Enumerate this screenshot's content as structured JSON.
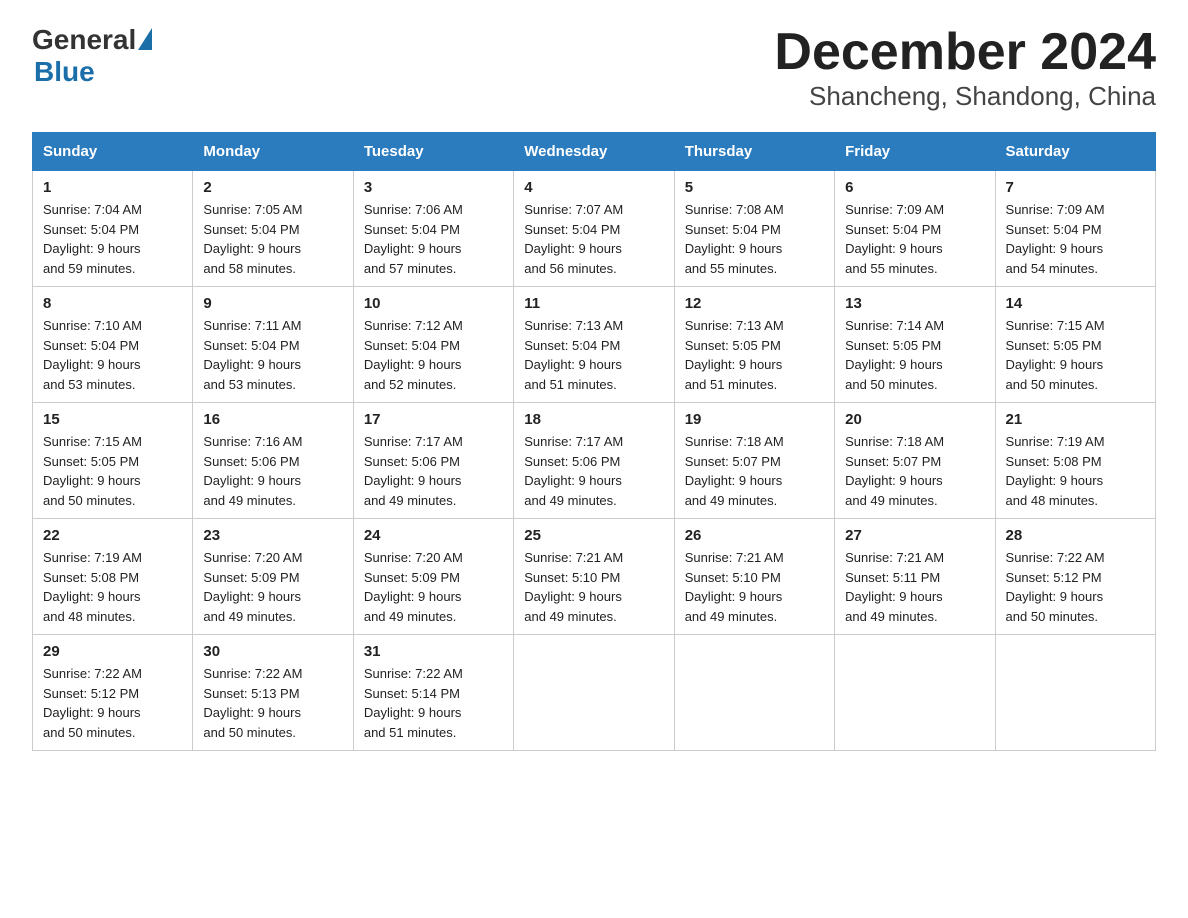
{
  "header": {
    "title": "December 2024",
    "subtitle": "Shancheng, Shandong, China",
    "logo_general": "General",
    "logo_blue": "Blue"
  },
  "columns": [
    "Sunday",
    "Monday",
    "Tuesday",
    "Wednesday",
    "Thursday",
    "Friday",
    "Saturday"
  ],
  "weeks": [
    [
      {
        "num": "1",
        "info": "Sunrise: 7:04 AM\nSunset: 5:04 PM\nDaylight: 9 hours\nand 59 minutes."
      },
      {
        "num": "2",
        "info": "Sunrise: 7:05 AM\nSunset: 5:04 PM\nDaylight: 9 hours\nand 58 minutes."
      },
      {
        "num": "3",
        "info": "Sunrise: 7:06 AM\nSunset: 5:04 PM\nDaylight: 9 hours\nand 57 minutes."
      },
      {
        "num": "4",
        "info": "Sunrise: 7:07 AM\nSunset: 5:04 PM\nDaylight: 9 hours\nand 56 minutes."
      },
      {
        "num": "5",
        "info": "Sunrise: 7:08 AM\nSunset: 5:04 PM\nDaylight: 9 hours\nand 55 minutes."
      },
      {
        "num": "6",
        "info": "Sunrise: 7:09 AM\nSunset: 5:04 PM\nDaylight: 9 hours\nand 55 minutes."
      },
      {
        "num": "7",
        "info": "Sunrise: 7:09 AM\nSunset: 5:04 PM\nDaylight: 9 hours\nand 54 minutes."
      }
    ],
    [
      {
        "num": "8",
        "info": "Sunrise: 7:10 AM\nSunset: 5:04 PM\nDaylight: 9 hours\nand 53 minutes."
      },
      {
        "num": "9",
        "info": "Sunrise: 7:11 AM\nSunset: 5:04 PM\nDaylight: 9 hours\nand 53 minutes."
      },
      {
        "num": "10",
        "info": "Sunrise: 7:12 AM\nSunset: 5:04 PM\nDaylight: 9 hours\nand 52 minutes."
      },
      {
        "num": "11",
        "info": "Sunrise: 7:13 AM\nSunset: 5:04 PM\nDaylight: 9 hours\nand 51 minutes."
      },
      {
        "num": "12",
        "info": "Sunrise: 7:13 AM\nSunset: 5:05 PM\nDaylight: 9 hours\nand 51 minutes."
      },
      {
        "num": "13",
        "info": "Sunrise: 7:14 AM\nSunset: 5:05 PM\nDaylight: 9 hours\nand 50 minutes."
      },
      {
        "num": "14",
        "info": "Sunrise: 7:15 AM\nSunset: 5:05 PM\nDaylight: 9 hours\nand 50 minutes."
      }
    ],
    [
      {
        "num": "15",
        "info": "Sunrise: 7:15 AM\nSunset: 5:05 PM\nDaylight: 9 hours\nand 50 minutes."
      },
      {
        "num": "16",
        "info": "Sunrise: 7:16 AM\nSunset: 5:06 PM\nDaylight: 9 hours\nand 49 minutes."
      },
      {
        "num": "17",
        "info": "Sunrise: 7:17 AM\nSunset: 5:06 PM\nDaylight: 9 hours\nand 49 minutes."
      },
      {
        "num": "18",
        "info": "Sunrise: 7:17 AM\nSunset: 5:06 PM\nDaylight: 9 hours\nand 49 minutes."
      },
      {
        "num": "19",
        "info": "Sunrise: 7:18 AM\nSunset: 5:07 PM\nDaylight: 9 hours\nand 49 minutes."
      },
      {
        "num": "20",
        "info": "Sunrise: 7:18 AM\nSunset: 5:07 PM\nDaylight: 9 hours\nand 49 minutes."
      },
      {
        "num": "21",
        "info": "Sunrise: 7:19 AM\nSunset: 5:08 PM\nDaylight: 9 hours\nand 48 minutes."
      }
    ],
    [
      {
        "num": "22",
        "info": "Sunrise: 7:19 AM\nSunset: 5:08 PM\nDaylight: 9 hours\nand 48 minutes."
      },
      {
        "num": "23",
        "info": "Sunrise: 7:20 AM\nSunset: 5:09 PM\nDaylight: 9 hours\nand 49 minutes."
      },
      {
        "num": "24",
        "info": "Sunrise: 7:20 AM\nSunset: 5:09 PM\nDaylight: 9 hours\nand 49 minutes."
      },
      {
        "num": "25",
        "info": "Sunrise: 7:21 AM\nSunset: 5:10 PM\nDaylight: 9 hours\nand 49 minutes."
      },
      {
        "num": "26",
        "info": "Sunrise: 7:21 AM\nSunset: 5:10 PM\nDaylight: 9 hours\nand 49 minutes."
      },
      {
        "num": "27",
        "info": "Sunrise: 7:21 AM\nSunset: 5:11 PM\nDaylight: 9 hours\nand 49 minutes."
      },
      {
        "num": "28",
        "info": "Sunrise: 7:22 AM\nSunset: 5:12 PM\nDaylight: 9 hours\nand 50 minutes."
      }
    ],
    [
      {
        "num": "29",
        "info": "Sunrise: 7:22 AM\nSunset: 5:12 PM\nDaylight: 9 hours\nand 50 minutes."
      },
      {
        "num": "30",
        "info": "Sunrise: 7:22 AM\nSunset: 5:13 PM\nDaylight: 9 hours\nand 50 minutes."
      },
      {
        "num": "31",
        "info": "Sunrise: 7:22 AM\nSunset: 5:14 PM\nDaylight: 9 hours\nand 51 minutes."
      },
      {
        "num": "",
        "info": ""
      },
      {
        "num": "",
        "info": ""
      },
      {
        "num": "",
        "info": ""
      },
      {
        "num": "",
        "info": ""
      }
    ]
  ]
}
